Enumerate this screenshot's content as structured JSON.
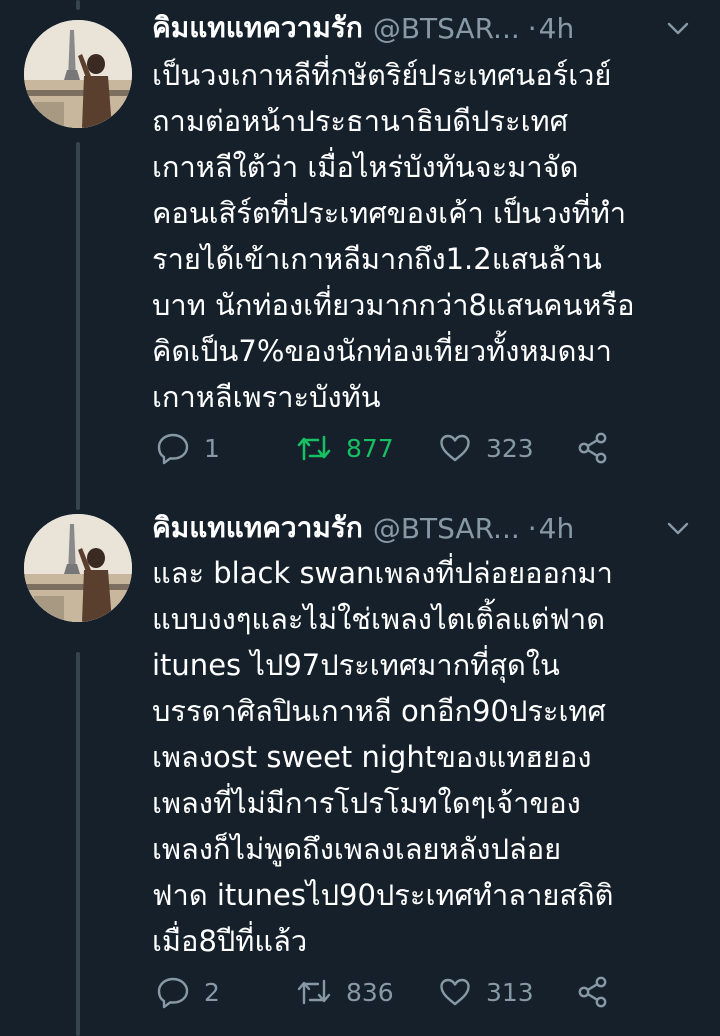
{
  "tweets": [
    {
      "author_name": "คิมแทแทความรัก",
      "handle": "@BTSAR...",
      "separator": "·",
      "time": "4h",
      "lines": [
        "เป็นวงเกาหลีที่กษัตริย์ประเทศนอร์เวย์",
        "ถามต่อหน้าประธานาธิบดีประเทศ",
        "เกาหลีใต้ว่า เมื่อไหร่บังทันจะมาจัด",
        "คอนเสิร์ตที่ประเทศของเค้า เป็นวงที่ทำ",
        "รายได้เข้าเกาหลีมากถึง1.2แสนล้าน",
        "บาท นักท่องเที่ยวมากกว่า8แสนคนหรือ",
        "คิดเป็น7%ของนักท่องเที่ยวทั้งหมดมา",
        "เกาหลีเพราะบังทัน"
      ],
      "replies": "1",
      "retweets": "877",
      "likes": "323",
      "retweeted": true,
      "icons": {
        "reply": "reply-icon",
        "retweet": "retweet-icon",
        "like": "heart-icon",
        "share": "share-icon",
        "menu": "chevron-down-icon"
      }
    },
    {
      "author_name": "คิมแทแทความรัก",
      "handle": "@BTSAR...",
      "separator": "·",
      "time": "4h",
      "lines": [
        "และ black swanเพลงที่ปล่อยออกมา",
        "แบบงงๆและไม่ใช่เพลงไตเติ้ลแต่ฟาด",
        "itunes ไป97ประเทศมากที่สุดใน",
        "บรรดาศิลปินเกาหลี onอีก90ประเทศ",
        "เพลงost sweet nightของแทฮยอง",
        "เพลงที่ไม่มีการโปรโมทใดๆเจ้าของ",
        "เพลงก็ไม่พูดถึงเพลงเลยหลังปล่อย",
        "ฟาด itunesไป90ประเทศทำลายสถิติ",
        "เมื่อ8ปีที่แล้ว"
      ],
      "replies": "2",
      "retweets": "836",
      "likes": "313",
      "retweeted": false,
      "icons": {
        "reply": "reply-icon",
        "retweet": "retweet-icon",
        "like": "heart-icon",
        "share": "share-icon",
        "menu": "chevron-down-icon"
      }
    }
  ],
  "colors": {
    "background": "#15202b",
    "text_primary": "#ffffff",
    "text_secondary": "#8899a6",
    "retweet_active": "#17bf63",
    "thread_line": "#38444d"
  }
}
